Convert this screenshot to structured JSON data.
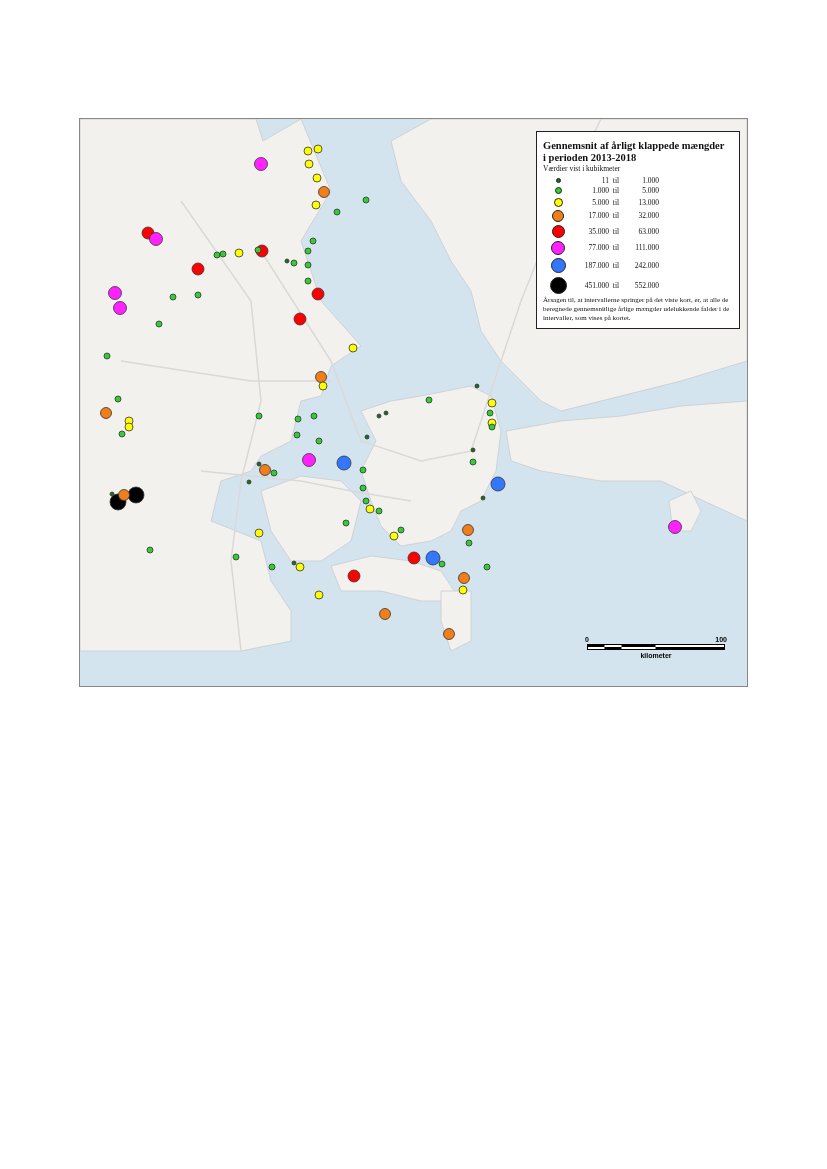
{
  "legend": {
    "title_lines": [
      "Gennemsnit af årligt klappede mængder",
      "i perioden 2013-2018"
    ],
    "subtitle": "Værdier vist i kubikmeter",
    "classes": [
      {
        "from": "11",
        "sep": "til",
        "to": "1.000",
        "color": "#1e6b1e"
      },
      {
        "from": "1.000",
        "sep": "til",
        "to": "5.000",
        "color": "#33cc33"
      },
      {
        "from": "5.000",
        "sep": "til",
        "to": "13.000",
        "color": "#ffff00"
      },
      {
        "from": "17.000",
        "sep": "til",
        "to": "32.000",
        "color": "#f07f1a"
      },
      {
        "from": "35.000",
        "sep": "til",
        "to": "63.000",
        "color": "#ff0000"
      },
      {
        "from": "77.000",
        "sep": "til",
        "to": "111.000",
        "color": "#ff22ff"
      },
      {
        "from": "187.000",
        "sep": "til",
        "to": "242.000",
        "color": "#3377ff"
      },
      {
        "from": "451.000",
        "sep": "til",
        "to": "552.000",
        "color": "#000000"
      }
    ],
    "note": "Årsagen til, at intervallerne springer på det viste kort, er, at alle de beregnede gennemsnitlige årlige mængder udelukkende falder i de intervaller, som vises på kortet."
  },
  "scale_bar": {
    "start": "0",
    "end": "100",
    "unit": "kilometer"
  }
}
